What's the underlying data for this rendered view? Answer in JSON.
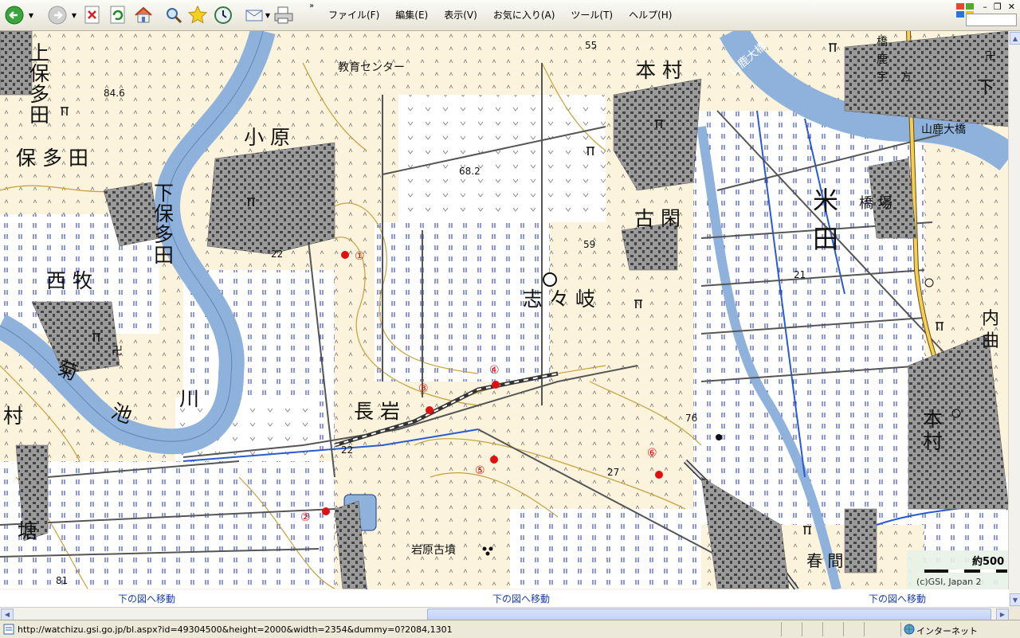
{
  "menu": [
    "ファイル(F)",
    "編集(E)",
    "表示(V)",
    "お気に入り(A)",
    "ツール(T)",
    "ヘルプ(H)"
  ],
  "map": {
    "places": {
      "kamihotada": [
        "上",
        "保",
        "多",
        "田"
      ],
      "hotada": "保 多 田",
      "shimohotada": [
        "下",
        "保",
        "多",
        "田"
      ],
      "nishimaki": "西 牧",
      "kikuchigawa": [
        "菊",
        "池",
        "川"
      ],
      "mura_left": "村",
      "kyoiku": "教育センター",
      "ohara": "小 原",
      "honmura_top": "本 村",
      "kogan": "古 閑",
      "shishiki": "志 々 岐",
      "nagaiwa": "長 岩",
      "yoneda": [
        "米",
        "田"
      ],
      "hashiba": "橋 場",
      "yamaga_ohashi": "山鹿大橋",
      "yamaga_ohashi_road": "山鹿大橋",
      "honmura_right": [
        "本",
        "村"
      ],
      "uchimagari": [
        "内",
        "曲"
      ],
      "shita": "下",
      "tsutsumi": "塘",
      "iwabaru_kofun": "岩原古墳",
      "haruma": "春 間",
      "shitahashi": [
        "橋",
        "鹿",
        "宇",
        "方"
      ]
    },
    "elevations": [
      "84.6",
      "68.2",
      "55",
      "59",
      "22",
      "22",
      "21",
      "27",
      "76",
      "81"
    ],
    "markers": [
      "①",
      "②",
      "③",
      "④",
      "⑤",
      "⑥"
    ],
    "scale_label": "約500",
    "copyright": "(c)GSI, Japan 2"
  },
  "links": [
    "下の図へ移動",
    "下の図へ移動",
    "下の図へ移動"
  ],
  "status": {
    "url": "http://watchizu.gsi.go.jp/bl.aspx?id=49304500&height=2000&width=2354&dummy=0?2084,1301",
    "zone": "インターネット"
  }
}
